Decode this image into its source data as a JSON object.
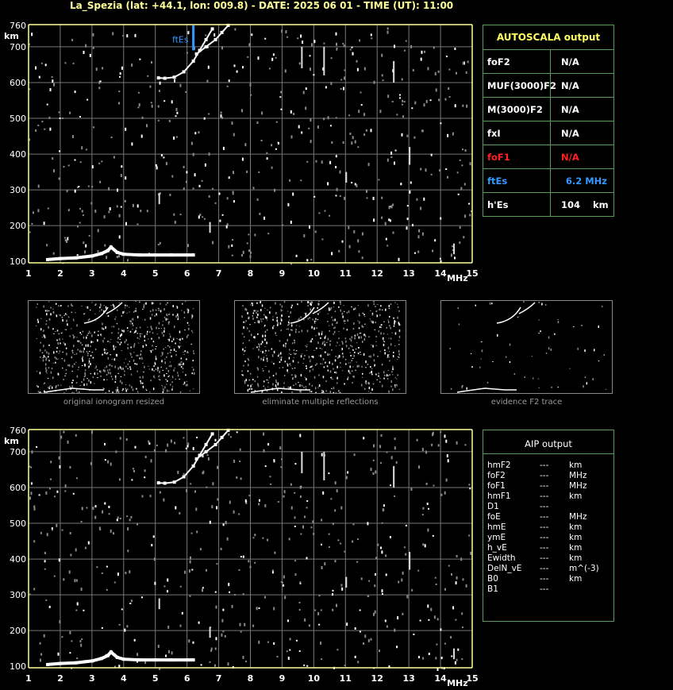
{
  "header": {
    "title": "La_Spezia (lat: +44.1, lon: 009.8) - DATE: 2025 06 01 - TIME (UT): 11:00"
  },
  "colors": {
    "axis": "#ffff99",
    "grid": "#777777",
    "trace": "#ffffff",
    "es_marker": "#3399ff",
    "panel_border": "#5a9a5a",
    "autoscala_title": "#ffff66",
    "fof1": "#ff2020",
    "ftes": "#3399ff"
  },
  "chart_data": [
    {
      "type": "scatter",
      "name": "main-ionogram",
      "xlabel": "MHz",
      "ylabel": "km",
      "xlim": [
        1,
        15
      ],
      "ylim": [
        96,
        762
      ],
      "x_ticks": [
        "1",
        "2",
        "3",
        "4",
        "5",
        "6",
        "7",
        "8",
        "9",
        "10",
        "11",
        "12",
        "13",
        "14",
        "15"
      ],
      "y_ticks": [
        "100",
        "200",
        "300",
        "400",
        "500",
        "600",
        "700",
        "760"
      ],
      "grid": true,
      "traces": [
        {
          "name": "Es layer",
          "points": [
            [
              1.6,
              105
            ],
            [
              2.0,
              108
            ],
            [
              2.5,
              110
            ],
            [
              3.0,
              115
            ],
            [
              3.3,
              122
            ],
            [
              3.5,
              130
            ],
            [
              3.6,
              140
            ],
            [
              3.8,
              125
            ],
            [
              4.0,
              120
            ],
            [
              4.5,
              118
            ],
            [
              5.0,
              118
            ],
            [
              5.5,
              118
            ],
            [
              6.0,
              118
            ],
            [
              6.2,
              118
            ]
          ]
        },
        {
          "name": "F2 trace",
          "points": [
            [
              5.1,
              613
            ],
            [
              5.3,
              612
            ],
            [
              5.6,
              615
            ],
            [
              5.9,
              630
            ],
            [
              6.2,
              660
            ],
            [
              6.4,
              690
            ],
            [
              6.6,
              720
            ],
            [
              6.8,
              750
            ]
          ]
        },
        {
          "name": "F2 trace 2",
          "points": [
            [
              6.3,
              680
            ],
            [
              6.6,
              700
            ],
            [
              6.9,
              720
            ],
            [
              7.1,
              740
            ],
            [
              7.3,
              760
            ]
          ]
        }
      ],
      "annotations": [
        {
          "text": "ftEs",
          "x": 6.2,
          "y_range": [
            690,
            760
          ]
        }
      ]
    },
    {
      "type": "scatter",
      "name": "aip-ionogram",
      "xlabel": "MHz",
      "ylabel": "km",
      "xlim": [
        1,
        15
      ],
      "ylim": [
        96,
        762
      ],
      "x_ticks": [
        "1",
        "2",
        "3",
        "4",
        "5",
        "6",
        "7",
        "8",
        "9",
        "10",
        "11",
        "12",
        "13",
        "14",
        "15"
      ],
      "y_ticks": [
        "100",
        "200",
        "300",
        "400",
        "500",
        "600",
        "700",
        "760"
      ],
      "grid": true
    }
  ],
  "autoscala": {
    "title": "AUTOSCALA output",
    "rows": [
      {
        "name": "foF2",
        "value": "N/A",
        "unit": "",
        "color": "#ffffff"
      },
      {
        "name": "MUF(3000)F2",
        "value": "N/A",
        "unit": "",
        "color": "#ffffff"
      },
      {
        "name": "M(3000)F2",
        "value": "N/A",
        "unit": "",
        "color": "#ffffff"
      },
      {
        "name": "fxI",
        "value": "N/A",
        "unit": "",
        "color": "#ffffff"
      },
      {
        "name": "foF1",
        "value": "N/A",
        "unit": "",
        "color": "#ff2020"
      },
      {
        "name": "ftEs",
        "value": "6.2 MHz",
        "unit": "",
        "color": "#3399ff"
      },
      {
        "name": "h'Es",
        "value": "104",
        "unit": "km",
        "color": "#ffffff"
      }
    ]
  },
  "thumbnails": [
    {
      "caption": "original ionogram resized"
    },
    {
      "caption": "eliminate multiple reflections"
    },
    {
      "caption": "evidence F2 trace"
    }
  ],
  "aip": {
    "title": "AIP output",
    "rows": [
      {
        "name": "hmF2",
        "value": "---",
        "unit": "km"
      },
      {
        "name": "foF2",
        "value": "---",
        "unit": "MHz"
      },
      {
        "name": "foF1",
        "value": "---",
        "unit": "MHz"
      },
      {
        "name": "hmF1",
        "value": "---",
        "unit": "km"
      },
      {
        "name": "D1",
        "value": "---",
        "unit": ""
      },
      {
        "name": "foE",
        "value": "---",
        "unit": "MHz"
      },
      {
        "name": "hmE",
        "value": "---",
        "unit": "km"
      },
      {
        "name": "ymE",
        "value": "---",
        "unit": "km"
      },
      {
        "name": "h_vE",
        "value": "---",
        "unit": "km"
      },
      {
        "name": "Ewidth",
        "value": "---",
        "unit": "km"
      },
      {
        "name": "DelN_vE",
        "value": "---",
        "unit": "m^(-3)"
      },
      {
        "name": "B0",
        "value": "---",
        "unit": "km"
      },
      {
        "name": "B1",
        "value": "---",
        "unit": ""
      }
    ]
  }
}
